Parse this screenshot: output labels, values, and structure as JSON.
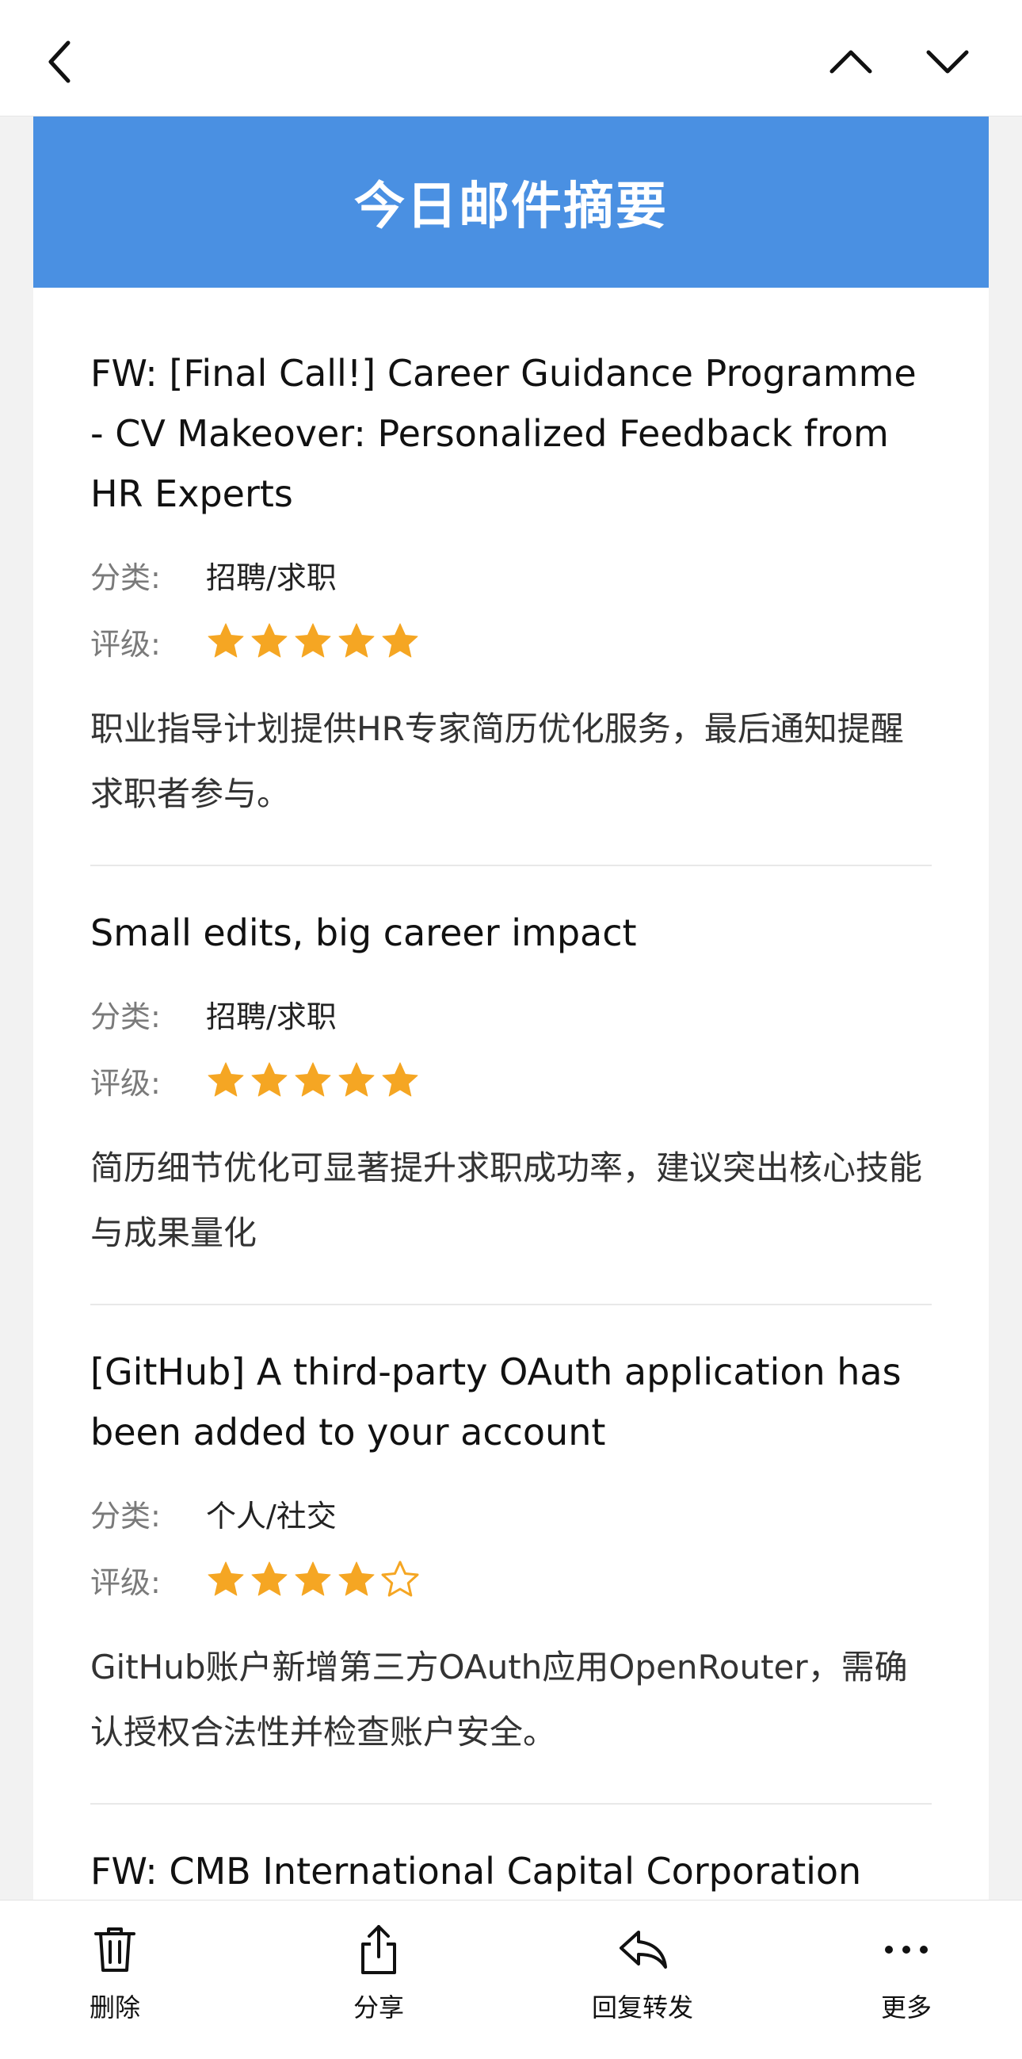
{
  "banner": {
    "title": "今日邮件摘要"
  },
  "labels": {
    "category": "分类:",
    "rating": "评级:"
  },
  "emails": [
    {
      "subject": "FW: [Final Call!] Career Guidance Programme - CV Makeover: Personalized Feedback from HR Experts",
      "category": "招聘/求职",
      "rating": 5,
      "rating_max": 5,
      "summary": "职业指导计划提供HR专家简历优化服务，最后通知提醒求职者参与。"
    },
    {
      "subject": "Small edits, big career impact",
      "category": "招聘/求职",
      "rating": 5,
      "rating_max": 5,
      "summary": "简历细节优化可显著提升求职成功率，建议突出核心技能与成果量化"
    },
    {
      "subject": "[GitHub] A third-party OAuth application has been added to your account",
      "category": "个人/社交",
      "rating": 4,
      "rating_max": 5,
      "summary": "GitHub账户新增第三方OAuth应用OpenRouter，需确认授权合法性并检查账户安全。"
    },
    {
      "subject": "FW: CMB International Capital Corporation Limited : On-Campus Recruitment Talk",
      "category": "",
      "rating": null,
      "rating_max": 5,
      "summary": ""
    }
  ],
  "toolbar": {
    "delete_label": "删除",
    "share_label": "分享",
    "reply_label": "回复转发",
    "more_label": "更多"
  },
  "icons": {
    "back": "chevron-left-icon",
    "prev": "chevron-up-icon",
    "next": "chevron-down-icon",
    "delete": "trash-icon",
    "share": "share-icon",
    "reply": "reply-icon",
    "more": "ellipsis-icon"
  },
  "colors": {
    "banner": "#4a90e2",
    "star": "#f5a623",
    "background": "#f2f2f2"
  }
}
